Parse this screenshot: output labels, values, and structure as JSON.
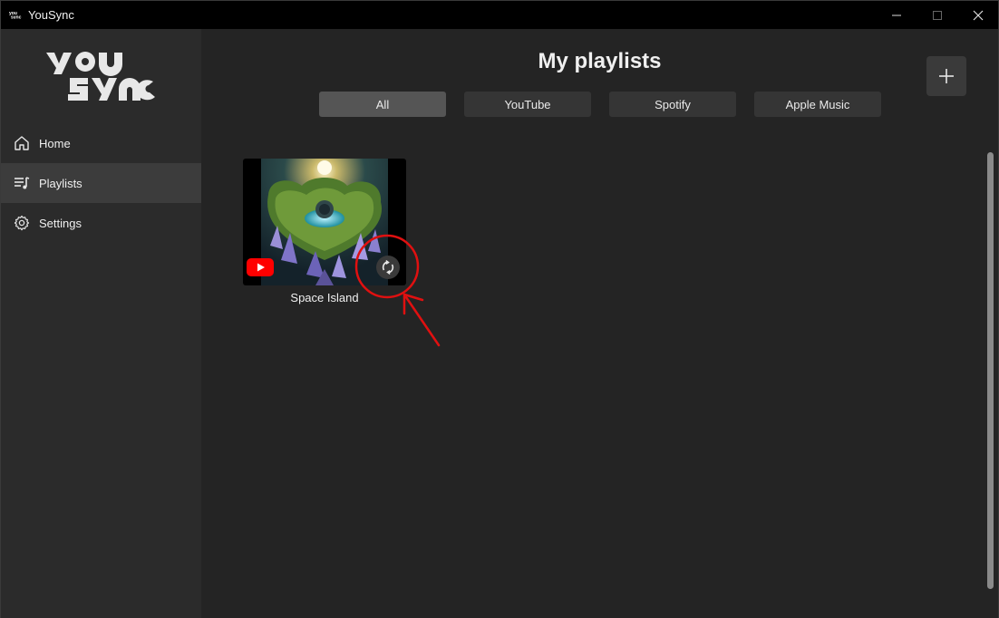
{
  "window": {
    "title": "YouSync",
    "app_icon": "yousync-small-logo",
    "controls": {
      "minimize": "minimize-icon",
      "maximize": "maximize-icon",
      "close": "close-icon"
    }
  },
  "sidebar": {
    "logo_text": "you sync",
    "items": [
      {
        "label": "Home",
        "icon": "home-icon",
        "active": false
      },
      {
        "label": "Playlists",
        "icon": "playlist-icon",
        "active": true
      },
      {
        "label": "Settings",
        "icon": "gear-icon",
        "active": false
      }
    ]
  },
  "main": {
    "title": "My playlists",
    "add_button_icon": "plus-icon",
    "filters": [
      {
        "label": "All",
        "selected": true
      },
      {
        "label": "YouTube",
        "selected": false
      },
      {
        "label": "Spotify",
        "selected": false
      },
      {
        "label": "Apple Music",
        "selected": false
      }
    ],
    "playlists": [
      {
        "name": "Space Island",
        "source_icon": "youtube-icon",
        "action_icon": "sync-icon"
      }
    ]
  },
  "colors": {
    "titlebar": "#000000",
    "sidebar": "#2b2b2b",
    "main": "#242424",
    "active_nav": "#3c3c3c",
    "selected_filter": "#555555",
    "filter": "#353535",
    "youtube_red": "#ff0000",
    "annotation_red": "#e01010"
  }
}
